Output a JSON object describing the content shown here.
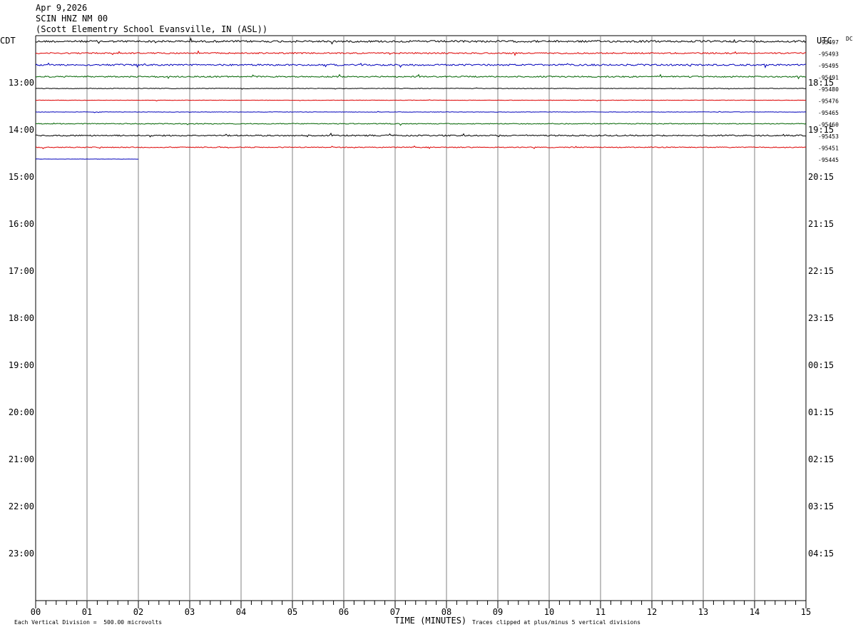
{
  "header": {
    "date": "Apr 9,2026",
    "station": "SCIN HNZ NM 00",
    "location": "(Scott Elementry School Evansville, IN (ASL))"
  },
  "left_axis_title": "CDT",
  "right_axis_title": "UTC",
  "dc_label": "DC",
  "footer": {
    "xlabel": "TIME (MINUTES)",
    "division_note": "Each Vertical Division =  500.00 microvolts",
    "clip_note": "Traces clipped at plus/minus 5 vertical divisions"
  },
  "colors": {
    "trace_cycle": [
      "#000000",
      "#dd0000",
      "#0000bb",
      "#006400"
    ],
    "grid": "#808080"
  },
  "chart_data": {
    "type": "line",
    "title": "SCIN HNZ NM 00",
    "xlabel": "TIME (MINUTES)",
    "x_ticks": [
      "00",
      "01",
      "02",
      "03",
      "04",
      "05",
      "06",
      "07",
      "08",
      "09",
      "10",
      "11",
      "12",
      "13",
      "14",
      "15"
    ],
    "xlim": [
      0,
      15
    ],
    "left_hour_labels": [
      "13:00",
      "14:00",
      "15:00",
      "16:00",
      "17:00",
      "18:00",
      "19:00",
      "20:00",
      "21:00",
      "22:00",
      "23:00"
    ],
    "right_hour_labels": [
      "18:15",
      "19:15",
      "20:15",
      "21:15",
      "22:15",
      "23:15",
      "00:15",
      "01:15",
      "02:15",
      "03:15",
      "04:15"
    ],
    "rows_per_hour": 4,
    "traces": [
      {
        "dc": "-95497",
        "end_min": 15,
        "noise": 1.3
      },
      {
        "dc": "-95493",
        "end_min": 15,
        "noise": 0.9
      },
      {
        "dc": "-95495",
        "end_min": 15,
        "noise": 1.1
      },
      {
        "dc": "-95491",
        "end_min": 15,
        "noise": 0.9
      },
      {
        "dc": "-95480",
        "end_min": 15,
        "noise": 0.4
      },
      {
        "dc": "-95476",
        "end_min": 15,
        "noise": 0.3
      },
      {
        "dc": "-95465",
        "end_min": 15,
        "noise": 0.3
      },
      {
        "dc": "-95460",
        "end_min": 15,
        "noise": 0.6
      },
      {
        "dc": "-95453",
        "end_min": 15,
        "noise": 0.9
      },
      {
        "dc": "-95451",
        "end_min": 15,
        "noise": 0.6
      },
      {
        "dc": "-95445",
        "end_min": 2,
        "noise": 0.2
      }
    ]
  }
}
